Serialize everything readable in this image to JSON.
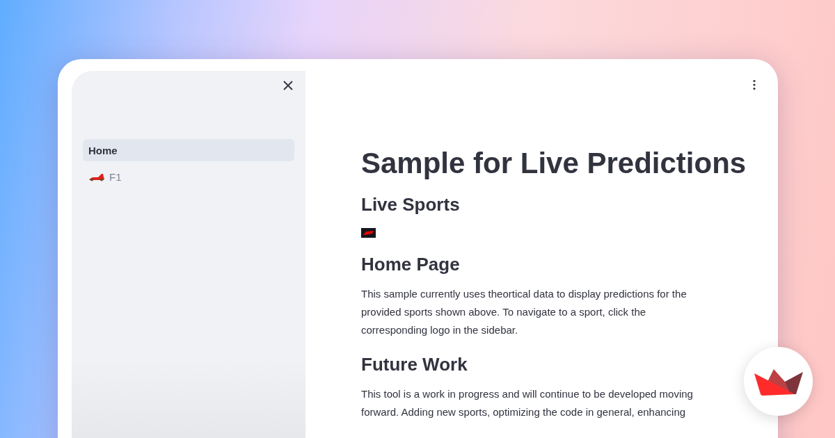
{
  "sidebar": {
    "items": [
      {
        "label": "Home",
        "kind": "text",
        "selected": true
      },
      {
        "label": "F1",
        "kind": "car",
        "selected": false
      }
    ]
  },
  "main": {
    "title": "Sample for Live Predictions",
    "sections": [
      {
        "kind": "heading",
        "text": "Live Sports"
      },
      {
        "kind": "logo"
      },
      {
        "kind": "heading",
        "text": "Home Page"
      },
      {
        "kind": "paragraph",
        "text": "This sample currently uses theortical data to display predictions for the provided sports shown above. To navigate to a sport, click the corresponding logo in the sidebar."
      },
      {
        "kind": "heading",
        "text": "Future Work"
      },
      {
        "kind": "paragraph",
        "text": "This tool is a work in progress and will continue to be developed moving forward. Adding new sports, optimizing the code in general, enhancing"
      }
    ]
  }
}
